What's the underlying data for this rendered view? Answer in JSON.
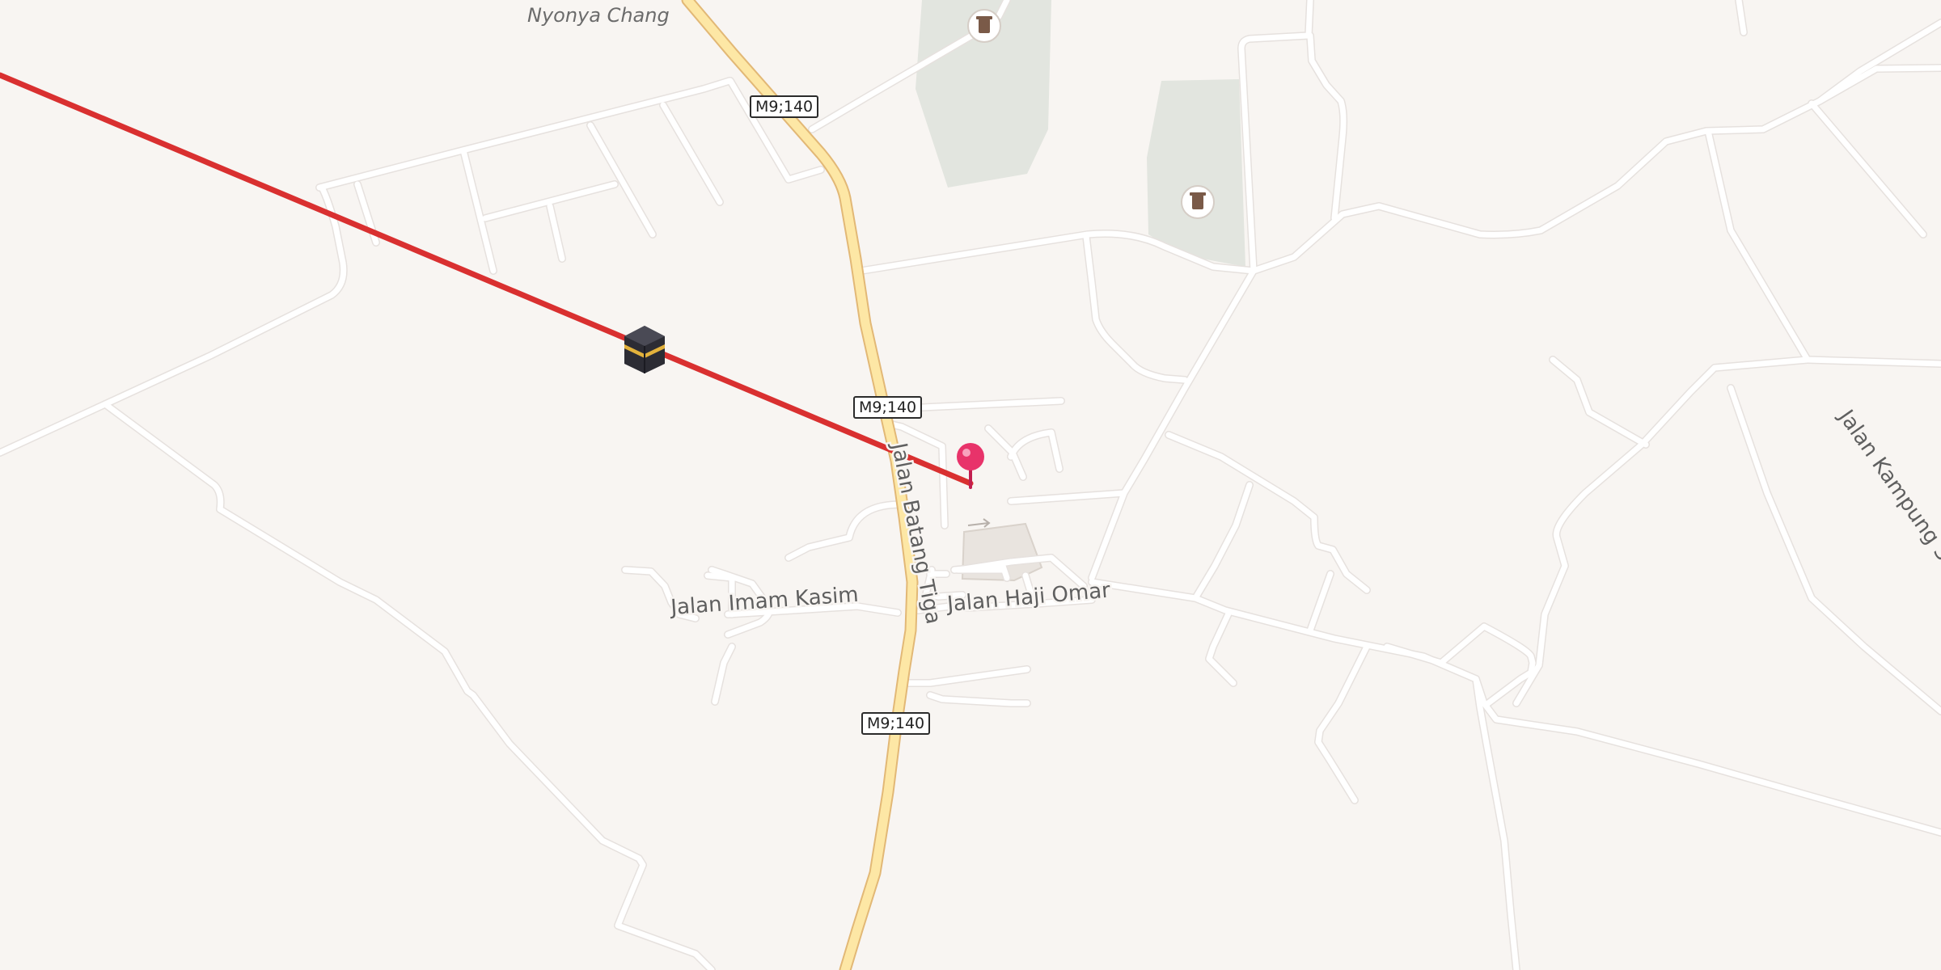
{
  "map": {
    "road_shields": [
      "M9;140",
      "M9;140",
      "M9;140"
    ],
    "street_labels": {
      "jalan_batang_tiga": "Jalan Batang Tiga",
      "jalan_imam_kasim": "Jalan Imam Kasim",
      "jalan_haji_omar": "Jalan Haji Omar",
      "jalan_kampung": "Jalan Kampung Se"
    },
    "place_labels": {
      "nyonya_chang": "Nyonya Chang"
    },
    "icons": {
      "location_pin": "location-pin-icon",
      "kaaba": "kaaba-icon",
      "cemetery_1": "cemetery-icon",
      "cemetery_2": "cemetery-icon"
    },
    "colors": {
      "background": "#f8f5f2",
      "trunk_road": "#fde7a5",
      "qibla_line": "#d93030",
      "pin": "#e8336a",
      "green_area": "#e2e5df"
    }
  }
}
